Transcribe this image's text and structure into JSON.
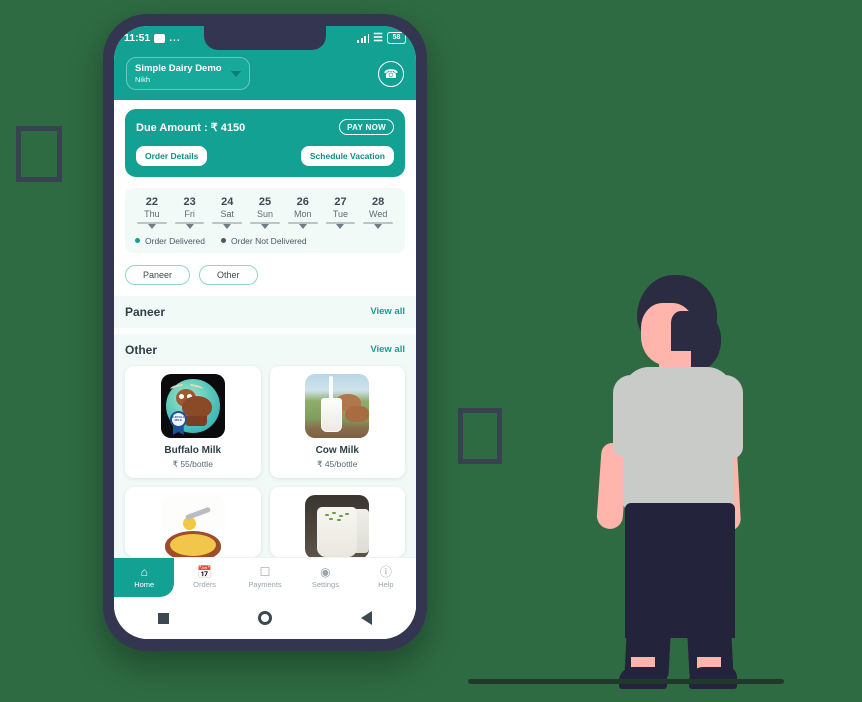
{
  "status_bar": {
    "time": "11:51",
    "message_icon": "message-icon",
    "more_dots": "...",
    "signal_icon": "signal-icon",
    "wifi_icon": "wifi-icon",
    "battery_level": "58"
  },
  "app_bar": {
    "business_name": "Simple Dairy Demo",
    "user_name": "Nikh",
    "dropdown_icon": "chevron-down-icon",
    "call_icon": "phone-call-icon"
  },
  "due_card": {
    "due_label": "Due Amount : ₹ 4150",
    "pay_now_label": "PAY NOW",
    "order_details_label": "Order Details",
    "schedule_vacation_label": "Schedule Vacation",
    "bg_color": "#13a193"
  },
  "date_strip": {
    "days": [
      {
        "num": "22",
        "day": "Thu"
      },
      {
        "num": "23",
        "day": "Fri"
      },
      {
        "num": "24",
        "day": "Sat"
      },
      {
        "num": "25",
        "day": "Sun"
      },
      {
        "num": "26",
        "day": "Mon"
      },
      {
        "num": "27",
        "day": "Tue"
      },
      {
        "num": "28",
        "day": "Wed"
      }
    ],
    "legend": [
      {
        "label": "Order Delivered",
        "color": "#13a193"
      },
      {
        "label": "Order Not Delivered",
        "color": "#4a5a62"
      }
    ]
  },
  "chips": [
    {
      "label": "Paneer"
    },
    {
      "label": "Other"
    }
  ],
  "sections": [
    {
      "title": "Paneer",
      "view_all": "View all"
    },
    {
      "title": "Other",
      "view_all": "View all"
    }
  ],
  "products": [
    {
      "name": "Buffalo Milk",
      "price": "₹ 55/bottle",
      "image": "buffalo-illustration"
    },
    {
      "name": "Cow Milk",
      "price": "₹ 45/bottle",
      "image": "cow-milk-photo"
    }
  ],
  "products_partial": [
    {
      "image": "ghee-spoon-photo"
    },
    {
      "image": "raita-glass-photo"
    }
  ],
  "bottom_nav": [
    {
      "label": "Home",
      "icon": "home-icon",
      "active": true
    },
    {
      "label": "Orders",
      "icon": "orders-icon",
      "active": false
    },
    {
      "label": "Payments",
      "icon": "payments-icon",
      "active": false
    },
    {
      "label": "Settings",
      "icon": "settings-icon",
      "active": false
    },
    {
      "label": "Help",
      "icon": "help-icon",
      "active": false
    }
  ],
  "android_nav": [
    {
      "icon": "recent-apps-square-icon"
    },
    {
      "icon": "home-circle-icon"
    },
    {
      "icon": "back-triangle-icon"
    }
  ],
  "theme": {
    "accent": "#13a193",
    "background": "#2e6b42",
    "phone_frame": "#343551"
  }
}
